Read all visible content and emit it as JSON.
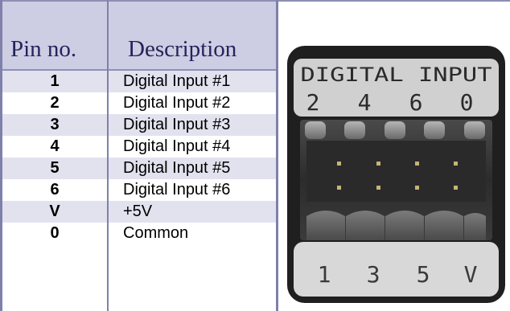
{
  "table": {
    "header_pin": "Pin no.",
    "header_desc": "Description",
    "rows": [
      {
        "pin": "1",
        "desc": "Digital Input #1"
      },
      {
        "pin": "2",
        "desc": "Digital Input #2"
      },
      {
        "pin": "3",
        "desc": "Digital Input #3"
      },
      {
        "pin": "4",
        "desc": "Digital Input #4"
      },
      {
        "pin": "5",
        "desc": "Digital Input #5"
      },
      {
        "pin": "6",
        "desc": "Digital Input #6"
      },
      {
        "pin": "V",
        "desc": "+5V"
      },
      {
        "pin": "0",
        "desc": "Common"
      }
    ]
  },
  "connector": {
    "label": "DIGITAL INPUT",
    "top_pins": [
      "2",
      "4",
      "6",
      "0"
    ],
    "bottom_pins": [
      "1",
      "3",
      "5",
      "V"
    ]
  },
  "colors": {
    "header_fill": "#cdcde3",
    "row_stripe": "#e2e2ef",
    "rule": "#7f81aa",
    "header_text": "#25235c"
  }
}
